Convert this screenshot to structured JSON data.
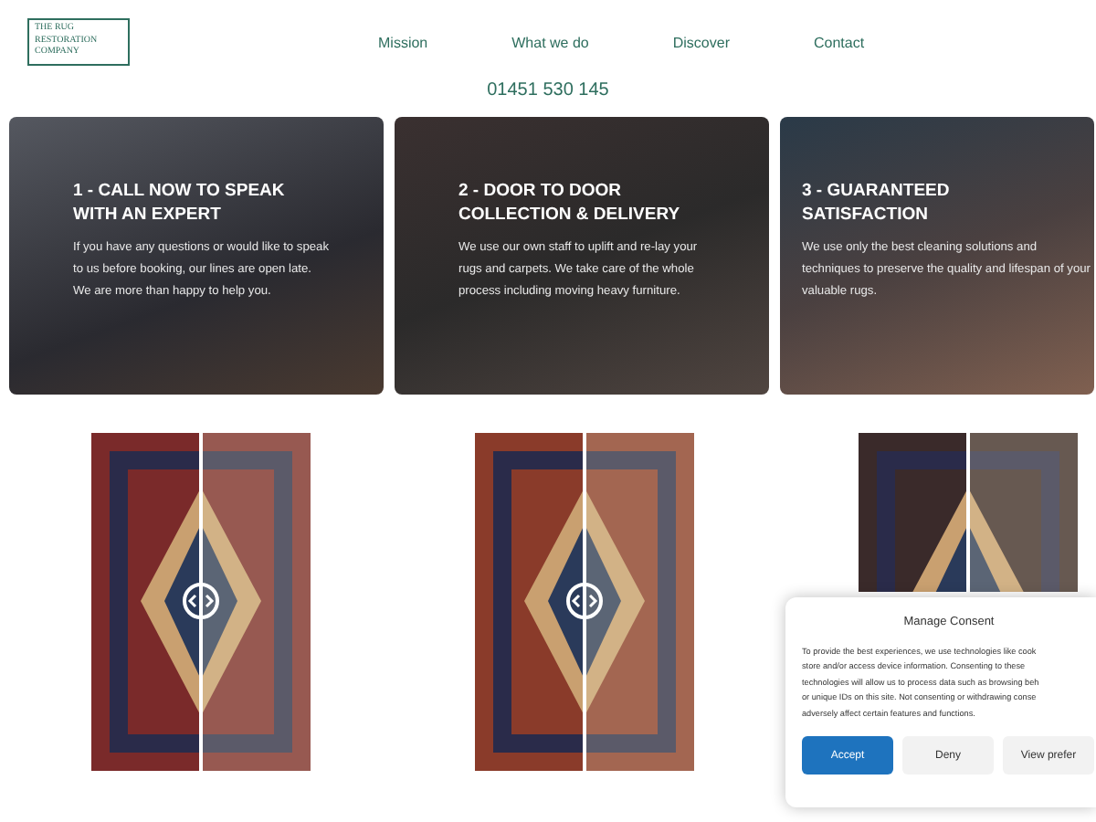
{
  "header": {
    "logo_lines": [
      "THE RUG",
      "RESTORATION",
      "COMPANY"
    ],
    "nav": [
      "Mission",
      "What we do",
      "Discover",
      "Contact"
    ],
    "phone": "01451 530 145"
  },
  "cards": [
    {
      "title": "1 - CALL NOW TO SPEAK WITH AN EXPERT",
      "text": "If you have any questions or would like to speak to us before booking, our lines are open late. We are more than happy to help you."
    },
    {
      "title": "2 - DOOR TO DOOR COLLECTION & DELIVERY",
      "text": "We use our own staff to uplift and re-lay your rugs and carpets. We take care of the whole process including moving heavy furniture."
    },
    {
      "title": "3 - GUARANTEED SATISFACTION",
      "text": "We use only the best cleaning solutions and techniques to preserve the quality and lifespan of your valuable rugs."
    }
  ],
  "rugs": [
    {
      "color": "#7a2a2a"
    },
    {
      "color": "#8a3b2a"
    },
    {
      "color": "#3a2a2a"
    }
  ],
  "consent": {
    "title": "Manage Consent",
    "lines": [
      "To provide the best experiences, we use technologies like cook",
      "store and/or access device information. Consenting to these",
      "technologies will allow us to process data such as browsing beh",
      "or unique IDs on this site. Not consenting or withdrawing conse",
      "adversely affect certain features and functions."
    ],
    "buttons": [
      {
        "label": "Accept",
        "kind": "primary"
      },
      {
        "label": "Deny",
        "kind": "secondary"
      },
      {
        "label": "View prefer",
        "kind": "secondary"
      }
    ]
  }
}
